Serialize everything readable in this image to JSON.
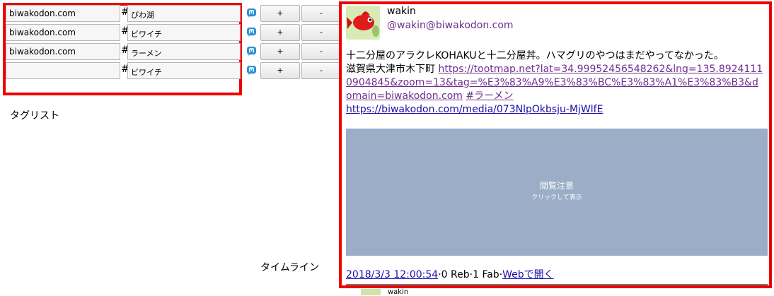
{
  "taglist": {
    "label": "タグリスト",
    "rows": [
      {
        "domain": "biwakodon.com",
        "hash": "#",
        "tag": "びわ湖",
        "plus": "+",
        "minus": "-"
      },
      {
        "domain": "biwakodon.com",
        "hash": "#",
        "tag": "ビワイチ",
        "plus": "+",
        "minus": "-"
      },
      {
        "domain": "biwakodon.com",
        "hash": "#",
        "tag": "ラーメン",
        "plus": "+",
        "minus": "-"
      },
      {
        "domain": "",
        "hash": "#",
        "tag": "ビワイチ",
        "plus": "+",
        "minus": "-"
      }
    ],
    "icon": "mastodon-icon",
    "accent": "#2b90d9"
  },
  "timeline": {
    "label": "タイムライン",
    "status": {
      "display_name": "wakin",
      "acct": "@wakin@biwakodon.com",
      "text_line1": "十二分屋のアラクレKOHAKUと十二分屋丼。ハマグリのやつはまだやってなかった。",
      "text_line2": "滋賀県大津市木下町 ",
      "map_link": "https://tootmap.net?lat=34.99952456548262&lng=135.89241110904845&zoom=13&tag=%E3%83%A9%E3%83%BC%E3%83%A1%E3%83%B3&domain=biwakodon.com",
      "hashtag": "#ラーメン",
      "media_link": "https://biwakodon.com/media/073NlpOkbsju-MjWlfE",
      "media_title": "閲覧注意",
      "media_sub": "クリックして表示",
      "timestamp": "2018/3/3 12:00:54",
      "sep1": "·",
      "reblogs": "0 Reb",
      "sep2": "·",
      "favs": "1 Fab",
      "sep3": "·",
      "web_link": "Webで開く"
    },
    "next_name": "wakin"
  },
  "colors": {
    "frame": "#ef0000",
    "link": "#1a0dab",
    "visited": "#6f2f8f",
    "media_bg": "#9badc7"
  }
}
